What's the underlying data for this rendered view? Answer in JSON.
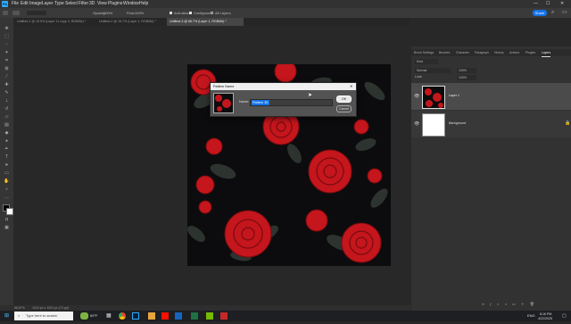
{
  "app": {
    "logo": "Ps"
  },
  "menu": [
    "File",
    "Edit",
    "Image",
    "Layer",
    "Type",
    "Select",
    "Filter",
    "3D",
    "View",
    "Plugins",
    "Window",
    "Help"
  ],
  "options": {
    "opacity_label": "Opacity:",
    "opacity_value": "100%",
    "flow_label": "Flow:",
    "flow_value": "100%",
    "anti_alias": "Anti-alias",
    "contiguous": "Contiguous",
    "all_layers": "All Layers",
    "share": "Share"
  },
  "tabs": [
    {
      "label": "Untitled-1 @ 15.5% (Layer 11 copy 4, RGB/8#) *"
    },
    {
      "label": "Untitled-2 @ 16.7% (Layer 1, RGB/8#) *"
    },
    {
      "label": "Untitled-3 @ 66.7% (Layer 1, RGB/8#) *"
    }
  ],
  "status": {
    "zoom": "66.67%",
    "doc": "1024 px x 1024 px (72 ppi)"
  },
  "panel": {
    "tabs": [
      "Brush Settings",
      "Brushes",
      "Character",
      "Paragraph",
      "History",
      "Actions",
      "Plugins",
      "Layers"
    ],
    "kind": "Kind",
    "blend": "Normal",
    "opacity": "100%",
    "lock": "Lock:",
    "fill": "100%",
    "layers": [
      {
        "name": "Layer 1"
      },
      {
        "name": "Background"
      }
    ]
  },
  "dialog": {
    "title": "Pattern Name",
    "name_label": "Name:",
    "name_value": "Pattern 35",
    "ok": "OK",
    "cancel": "Cancel"
  },
  "taskbar": {
    "search": "Type here to search",
    "weather": "69°F",
    "lang": "ENG",
    "time": "8:16 PM",
    "date": "4/22/2025"
  },
  "colors": {
    "accent": "#31a8ff",
    "rose": "#c4161c",
    "leaf": "#2d332f",
    "bg": "#0c0c0e"
  }
}
